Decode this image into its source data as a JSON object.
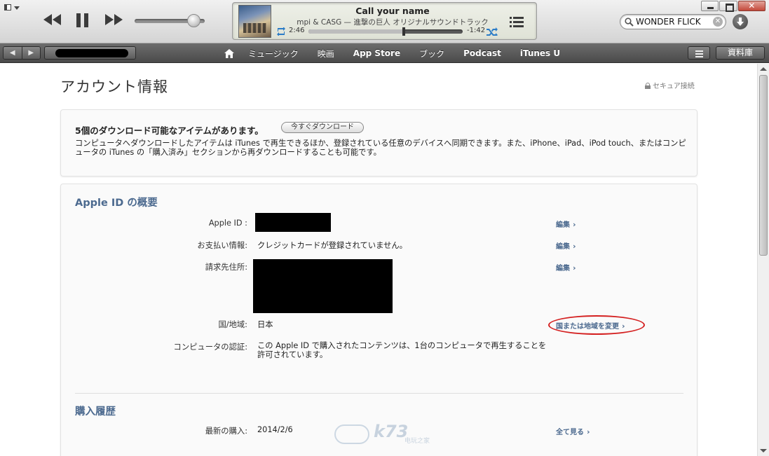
{
  "player": {
    "song": "Call your name",
    "artist_album": "mpi & CASG — 進撃の巨人 オリジナルサウンドトラック",
    "elapsed": "2:46",
    "remaining": "-1:42",
    "progress_fraction": 0.62,
    "volume_fraction": 0.84
  },
  "search": {
    "value": "WONDER FLICK",
    "icon": "search-icon"
  },
  "nav": {
    "links": [
      "ミュージック",
      "映画",
      "App Store",
      "ブック",
      "Podcast",
      "iTunes U"
    ],
    "library_label": "資料庫"
  },
  "page": {
    "title": "アカウント情報",
    "secure_label": "セキュア接続"
  },
  "downloads": {
    "title": "5個のダウンロード可能なアイテムがあります。",
    "button": "今すぐダウンロード",
    "description": "コンピュータへダウンロードしたアイテムは iTunes で再生できるほか、登録されている任意のデバイスへ同期できます。また、iPhone、iPad、iPod touch、またはコンピュータの iTunes の「購入済み」セクションから再ダウンロードすることも可能です。"
  },
  "overview": {
    "heading": "Apple ID の概要",
    "rows": {
      "apple_id_label": "Apple ID :",
      "payment_label": "お支払い情報:",
      "payment_value": "クレジットカードが登録されていません。",
      "billing_label": "請求先住所:",
      "country_label": "国/地域:",
      "country_value": "日本",
      "auth_label": "コンピュータの認証:",
      "auth_value": "この Apple ID で購入されたコンテンツは、1台のコンピュータで再生することを許可されています。"
    },
    "edit_label": "編集",
    "change_country_label": "国または地域を変更"
  },
  "history": {
    "heading": "購入履歴",
    "latest_label": "最新の購入:",
    "latest_value": "2014/2/6",
    "see_all": "全て見る"
  },
  "watermark": {
    "text": "k73",
    "sub": "电玩之家"
  },
  "colors": {
    "accent": "#4c6a8f",
    "highlight_ellipse": "#d42020",
    "nav_bg": "#5a5a5a"
  }
}
